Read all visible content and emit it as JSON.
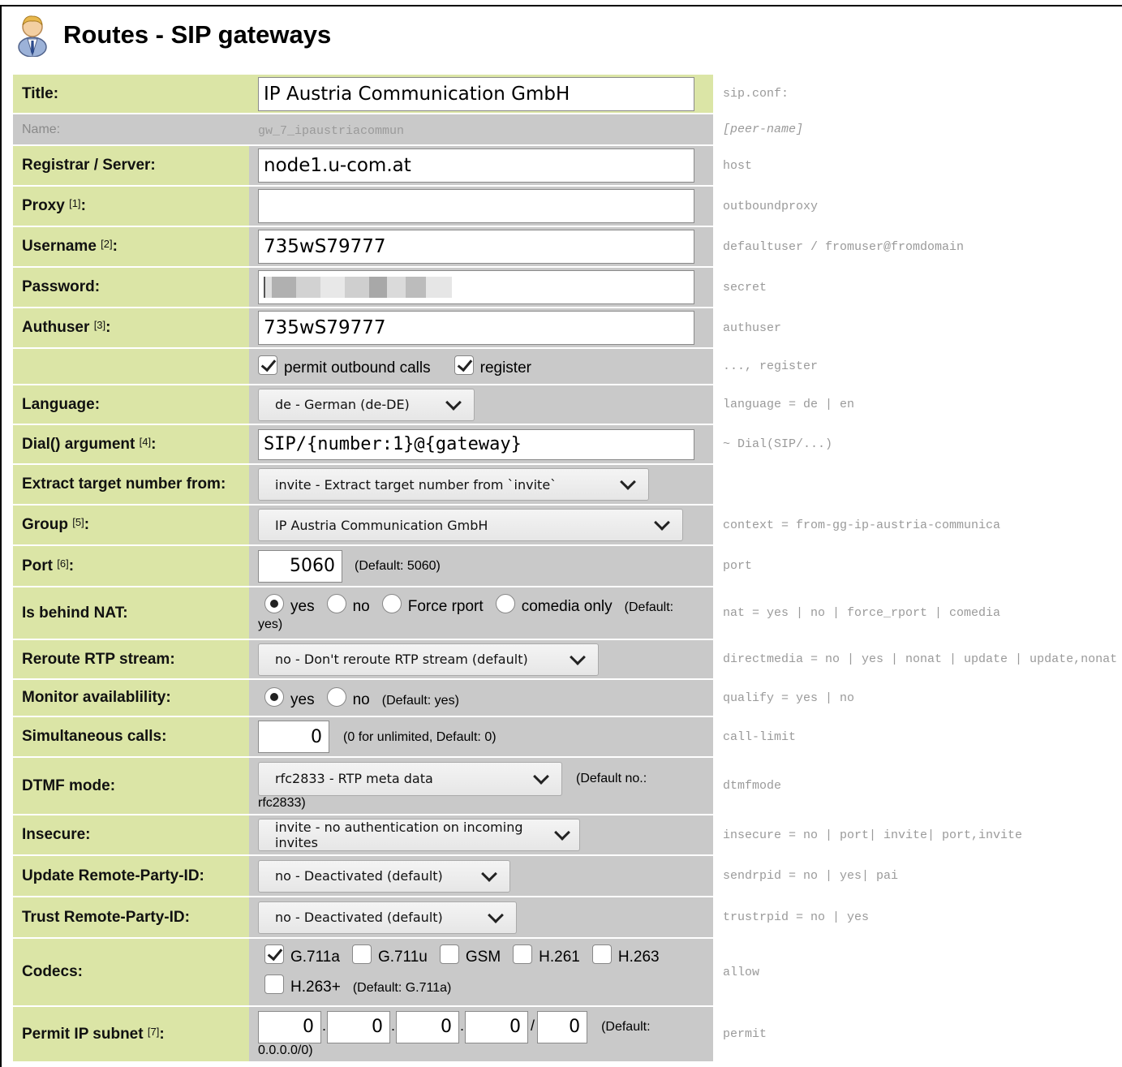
{
  "page": {
    "title": "Routes - SIP gateways"
  },
  "fields": {
    "title": {
      "label": "Title:",
      "value": "IP Austria Communication GmbH",
      "hint": "sip.conf:"
    },
    "name": {
      "label": "Name:",
      "value": "gw_7_ipaustriacommun",
      "hint": "[peer-name]"
    },
    "registrar": {
      "label": "Registrar / Server:",
      "value": "node1.u-com.at",
      "hint": "host"
    },
    "proxy": {
      "label": "Proxy",
      "note": "[1]",
      "value": "",
      "hint": "outboundproxy"
    },
    "username": {
      "label": "Username",
      "note": "[2]",
      "value": "735wS79777",
      "hint": "defaultuser / fromuser@fromdomain"
    },
    "password": {
      "label": "Password:",
      "hint": "secret"
    },
    "authuser": {
      "label": "Authuser",
      "note": "[3]",
      "value": "735wS79777",
      "hint": "authuser"
    },
    "flags": {
      "permit_label": "permit outbound calls",
      "permit_checked": true,
      "register_label": "register",
      "register_checked": true,
      "hint": "..., register"
    },
    "language": {
      "label": "Language:",
      "value": "de - German (de-DE)",
      "hint": "language = de | en"
    },
    "dial": {
      "label": "Dial() argument",
      "note": "[4]",
      "value": "SIP/{number:1}@{gateway}",
      "hint": "~ Dial(SIP/...)"
    },
    "extract": {
      "label": "Extract target number from:",
      "value": "invite - Extract target number from `invite`"
    },
    "group": {
      "label": "Group",
      "note": "[5]",
      "value": "IP Austria Communication GmbH",
      "hint": "context = from-gg-ip-austria-communica"
    },
    "port": {
      "label": "Port",
      "note": "[6]",
      "value": "5060",
      "default": "(Default: 5060)",
      "hint": "port"
    },
    "nat": {
      "label": "Is behind NAT:",
      "options": [
        "yes",
        "no",
        "Force rport",
        "comedia only"
      ],
      "selected": "yes",
      "default_a": "(Default:",
      "default_b": "yes)",
      "hint": "nat = yes | no | force_rport | comedia"
    },
    "reroute": {
      "label": "Reroute RTP stream:",
      "value": "no - Don't reroute RTP stream (default)",
      "hint": "directmedia = no | yes | nonat | update | update,nonat"
    },
    "monitor": {
      "label": "Monitor availablility:",
      "options": [
        "yes",
        "no"
      ],
      "selected": "yes",
      "default": "(Default: yes)",
      "hint": "qualify = yes | no"
    },
    "calls": {
      "label": "Simultaneous calls:",
      "value": "0",
      "default": "(0 for unlimited, Default: 0)",
      "hint": "call-limit"
    },
    "dtmf": {
      "label": "DTMF mode:",
      "value": "rfc2833 - RTP meta data",
      "default_a": "(Default no.:",
      "default_b": "rfc2833)",
      "hint": "dtmfmode"
    },
    "insecure": {
      "label": "Insecure:",
      "value": "invite - no authentication on incoming invites",
      "hint": "insecure = no | port| invite| port,invite"
    },
    "update_rpid": {
      "label": "Update Remote-Party-ID:",
      "value": "no - Deactivated (default)",
      "hint": "sendrpid = no | yes| pai"
    },
    "trust_rpid": {
      "label": "Trust Remote-Party-ID:",
      "value": "no - Deactivated (default)",
      "hint": "trustrpid = no | yes"
    },
    "codecs": {
      "label": "Codecs:",
      "items": [
        "G.711a",
        "G.711u",
        "GSM",
        "H.261",
        "H.263",
        "H.263+"
      ],
      "checked": [
        "G.711a"
      ],
      "default": "(Default: G.711a)",
      "hint": "allow"
    },
    "permit": {
      "label": "Permit IP subnet",
      "note": "[7]",
      "octets": [
        "0",
        "0",
        "0",
        "0"
      ],
      "mask": "0",
      "default_a": "(Default:",
      "default_b": "0.0.0.0/0)",
      "hint": "permit"
    }
  }
}
